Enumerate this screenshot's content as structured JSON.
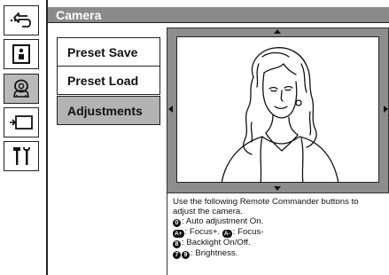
{
  "header": {
    "title": "Camera"
  },
  "sidebar": {
    "items": [
      {
        "name": "back-icon",
        "active": false
      },
      {
        "name": "user-info-icon",
        "active": false
      },
      {
        "name": "camera-person-icon",
        "active": true
      },
      {
        "name": "display-icon",
        "active": false
      },
      {
        "name": "tools-icon",
        "active": false
      }
    ]
  },
  "menu": {
    "items": [
      {
        "label": "Preset Save",
        "selected": false
      },
      {
        "label": "Preset Load",
        "selected": false
      },
      {
        "label": "Adjustments",
        "selected": true
      }
    ]
  },
  "info": {
    "intro": "Use the following Remote Commander buttons to adjust the camera.",
    "rows": [
      {
        "keys": [
          "0"
        ],
        "text": ": Auto adjustment On."
      },
      {
        "keys": [
          "+",
          "-"
        ],
        "text_a": ": Focus+.",
        "text_b": ": Focus-"
      },
      {
        "keys": [
          "8"
        ],
        "text": ": Backlight On/Off."
      },
      {
        "keys": [
          "7",
          "9"
        ],
        "text": ": Brightness."
      }
    ],
    "line1": "Use the following Remote Commander buttons to",
    "line2": "adjust the camera.",
    "auto": "0",
    "auto_text": ": Auto adjustment On.",
    "focus_plus_key": "+",
    "focus_plus_text": ": Focus+.",
    "focus_minus_key": "-",
    "focus_minus_text": ": Focus-",
    "backlight_key": "8",
    "backlight_text": ": Backlight On/Off.",
    "bright_key1": "7",
    "bright_key2": "9",
    "bright_text": ": Brightness."
  },
  "colors": {
    "header_bg": "#8a8a8a",
    "selected_bg": "#b3b3b3",
    "frame_bg": "#8d8d8d"
  }
}
